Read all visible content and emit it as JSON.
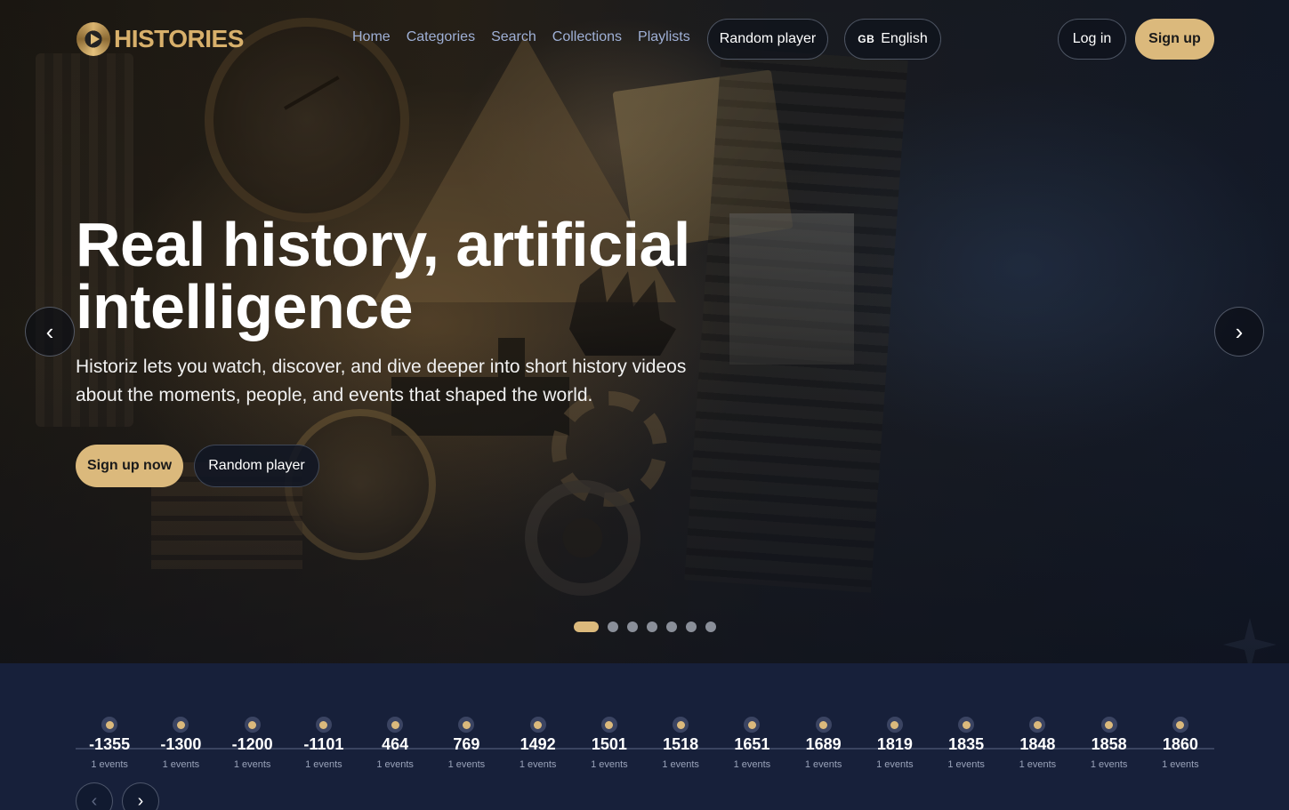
{
  "brand": {
    "name": "HISTORIES"
  },
  "nav": {
    "links": [
      "Home",
      "Categories",
      "Search",
      "Collections",
      "Playlists"
    ],
    "random_player": "Random player",
    "language": {
      "flag": "GB",
      "label": "English"
    },
    "login": "Log in",
    "signup": "Sign up"
  },
  "hero": {
    "title": "Real history, artificial intelligence",
    "subtitle": "Historiz lets you watch, discover, and dive deeper into short history videos about the moments, people, and events that shaped the world.",
    "cta_primary": "Sign up now",
    "cta_secondary": "Random player",
    "prev_icon": "‹",
    "next_icon": "›",
    "slides_total": 7,
    "active_slide": 1
  },
  "timeline": {
    "items": [
      {
        "year": "-1355",
        "count": "1 events"
      },
      {
        "year": "-1300",
        "count": "1 events"
      },
      {
        "year": "-1200",
        "count": "1 events"
      },
      {
        "year": "-1101",
        "count": "1 events"
      },
      {
        "year": "464",
        "count": "1 events"
      },
      {
        "year": "769",
        "count": "1 events"
      },
      {
        "year": "1492",
        "count": "1 events"
      },
      {
        "year": "1501",
        "count": "1 events"
      },
      {
        "year": "1518",
        "count": "1 events"
      },
      {
        "year": "1651",
        "count": "1 events"
      },
      {
        "year": "1689",
        "count": "1 events"
      },
      {
        "year": "1819",
        "count": "1 events"
      },
      {
        "year": "1835",
        "count": "1 events"
      },
      {
        "year": "1848",
        "count": "1 events"
      },
      {
        "year": "1858",
        "count": "1 events"
      },
      {
        "year": "1860",
        "count": "1 events"
      }
    ],
    "prev_icon": "‹",
    "next_icon": "›"
  },
  "colors": {
    "accent_gold": "#dbb97c",
    "nav_link": "#9fb0d6",
    "timeline_bg": "#17203a"
  }
}
